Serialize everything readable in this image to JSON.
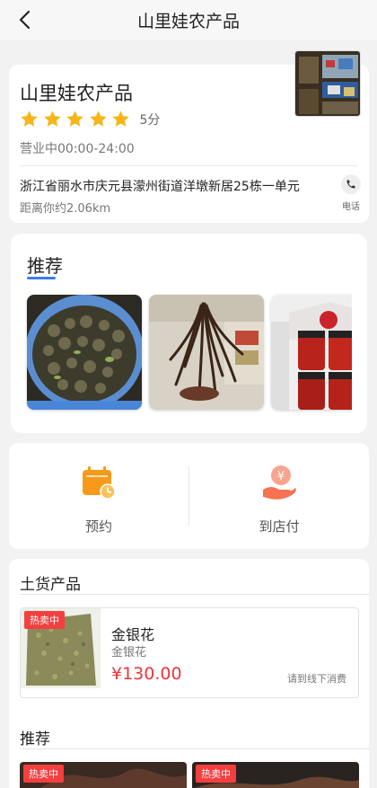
{
  "navbar": {
    "title": "山里娃农产品",
    "back_icon": "chevron-left-icon"
  },
  "shop": {
    "name": "山里娃农产品",
    "rating": 5,
    "rating_text": "5分",
    "hours": "营业中00:00-24:00",
    "address": "浙江省丽水市庆元县濛州街道洋墩新居25栋一单元",
    "distance": "距离你约2.06km",
    "phone_label": "电话"
  },
  "recommend": {
    "title": "推荐",
    "images": [
      "snails-photo",
      "dried-herbs-photo",
      "chili-sauce-jars-photo"
    ]
  },
  "actions": [
    {
      "label": "预约",
      "icon": "calendar-icon"
    },
    {
      "label": "到店付",
      "icon": "yuan-hand-icon"
    }
  ],
  "products": {
    "title": "土货产品",
    "items": [
      {
        "badge": "热卖中",
        "name": "金银花",
        "subtitle": "金银花",
        "price": "¥130.00",
        "note": "请到线下消费"
      }
    ]
  },
  "recommend2": {
    "title": "推荐",
    "items": [
      {
        "badge": "热卖中"
      },
      {
        "badge": "热卖中"
      }
    ]
  },
  "colors": {
    "accent_blue": "#3b7ef0",
    "star": "#f7b519",
    "price": "#f0323a",
    "badge": "#f43f3f",
    "orange_icon": "#f79a1a",
    "salmon_icon": "#f57350"
  }
}
